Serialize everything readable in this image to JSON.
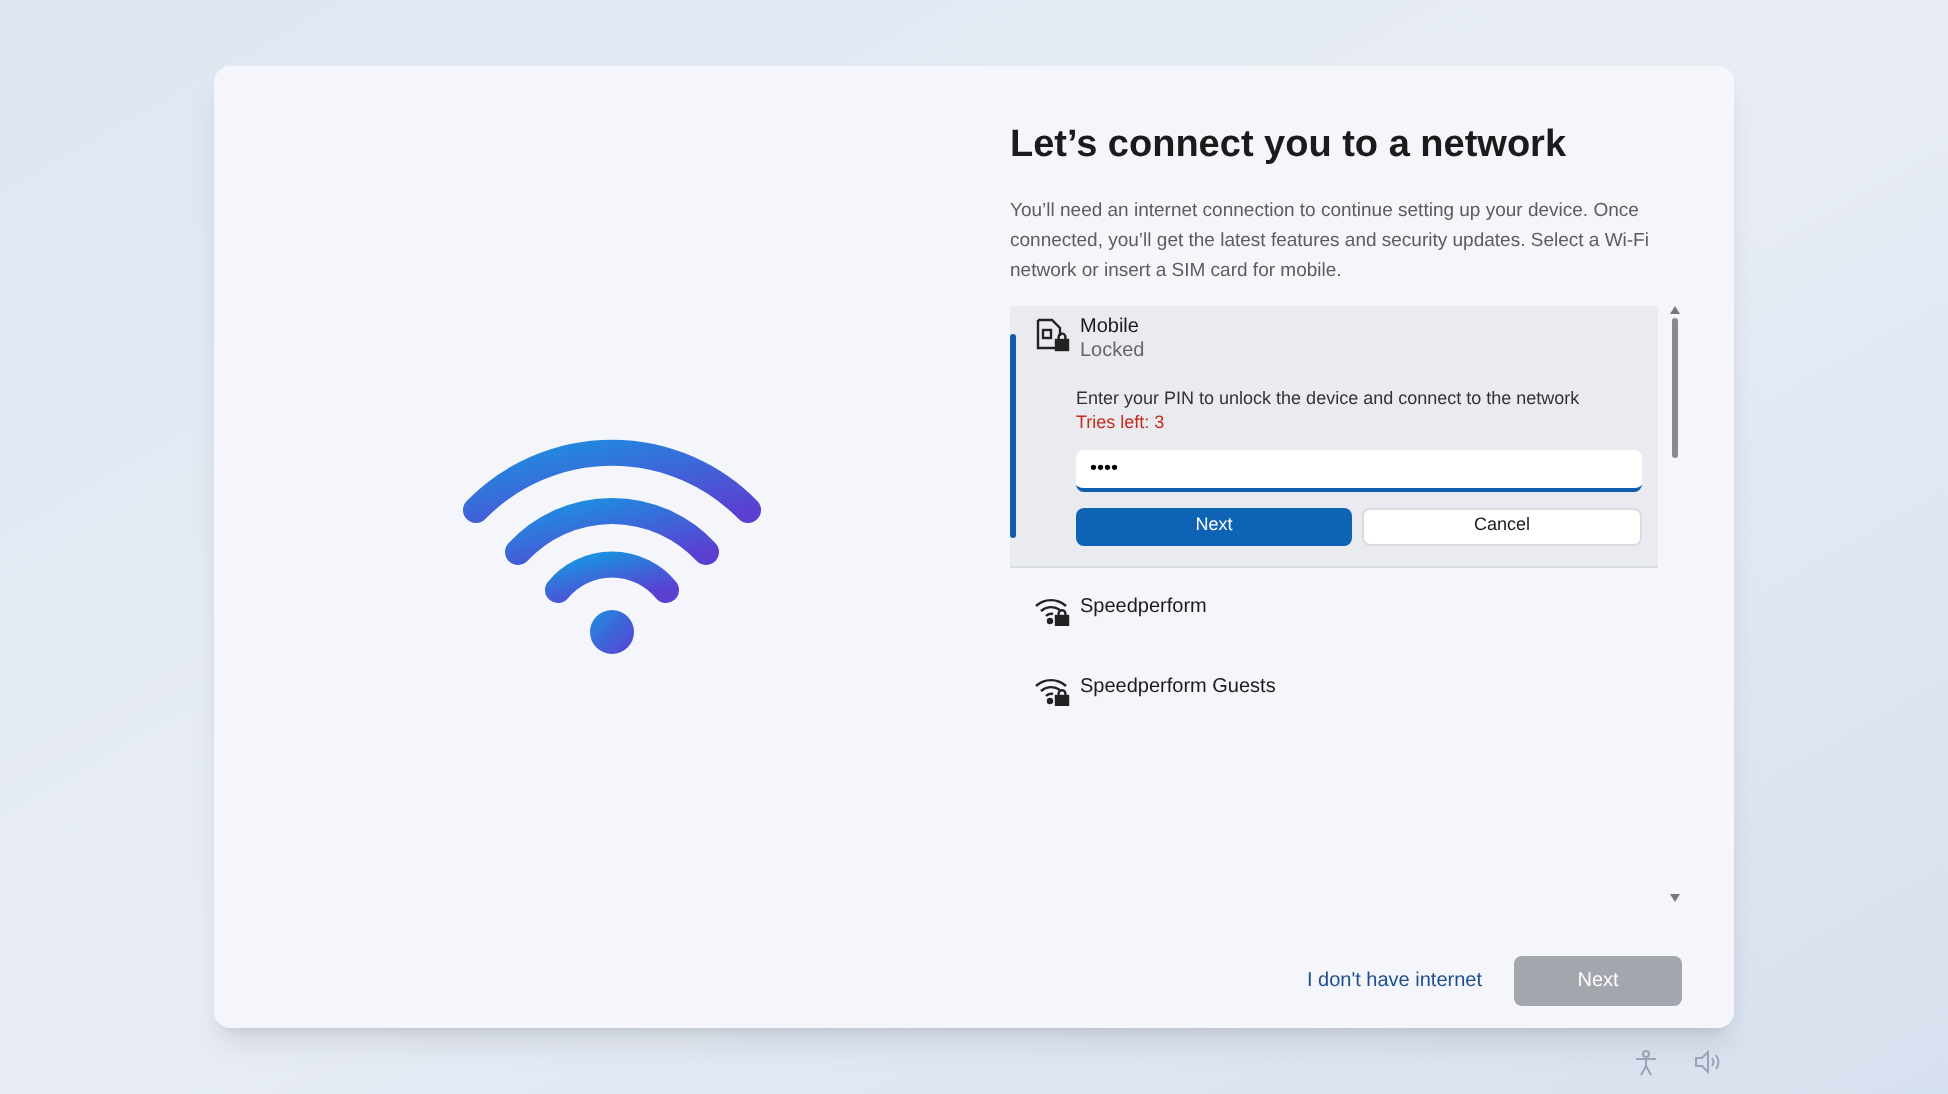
{
  "heading": "Let’s connect you to a network",
  "description": "You’ll need an internet connection to continue setting up your device. Once connected, you’ll get the latest features and security updates. Select a Wi-Fi network or insert a SIM card for mobile.",
  "networks": [
    {
      "kind": "mobile",
      "name": "Mobile",
      "status": "Locked",
      "selected": true,
      "prompt": "Enter your PIN to unlock the device and connect to the network",
      "warning": "Tries left: 3",
      "pin": "••••",
      "buttons": [
        {
          "label": "Next",
          "primary": true
        },
        {
          "label": "Cancel",
          "primary": false
        }
      ]
    },
    {
      "kind": "wifi",
      "name": "Speedperform",
      "selected": false
    },
    {
      "kind": "wifi",
      "name": "Speedperform Guests",
      "selected": false
    }
  ],
  "footer": {
    "link": "I don't have internet",
    "next": {
      "label": "Next",
      "disabled": true
    }
  }
}
